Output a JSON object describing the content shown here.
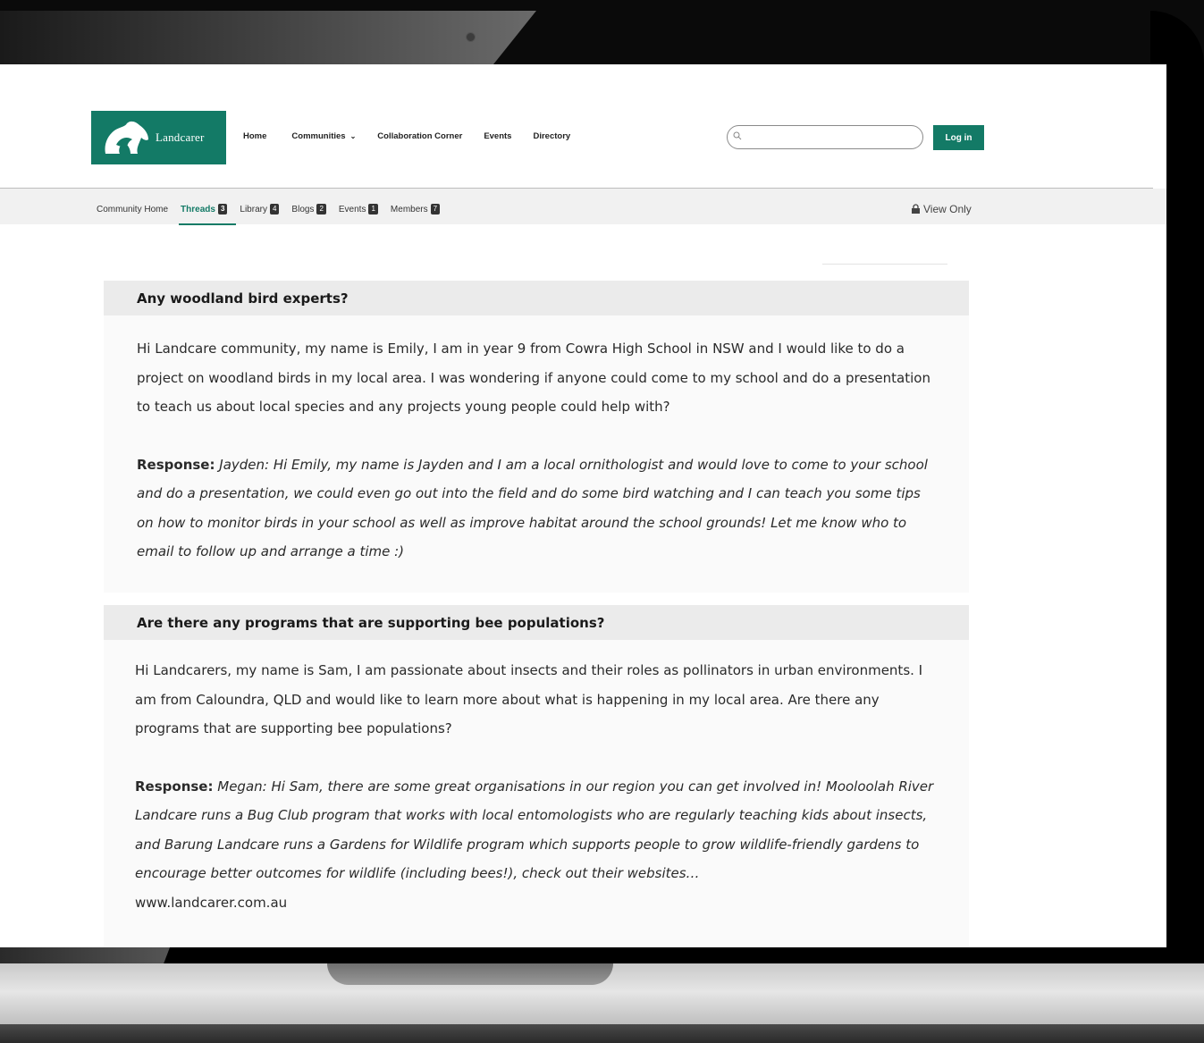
{
  "header": {
    "logo_text": "Landcarer",
    "nav": {
      "home": "Home",
      "communities": "Communities",
      "collaboration": "Collaboration Corner",
      "events": "Events",
      "directory": "Directory"
    },
    "search_placeholder": "",
    "login_label": "Log in"
  },
  "subnav": {
    "tabs": [
      {
        "label": "Community Home",
        "count": ""
      },
      {
        "label": "Threads",
        "count": "3"
      },
      {
        "label": "Library",
        "count": "4"
      },
      {
        "label": "Blogs",
        "count": "2"
      },
      {
        "label": "Events",
        "count": "1"
      },
      {
        "label": "Members",
        "count": "7"
      }
    ],
    "active_tab": "Threads",
    "view_only": "View Only"
  },
  "threads": [
    {
      "title": "Any woodland bird experts?",
      "body": "Hi Landcare community, my name is Emily, I am in year 9 from Cowra High School in NSW and I would like to do a project on woodland birds in my local area. I was wondering if anyone could come to my school and do a presentation to teach us about local species and any projects young people could help with?",
      "response_label": "Response:",
      "response": "Jayden: Hi Emily, my name is Jayden and I am a local ornithologist and would love to come to your school and do a presentation, we could even go out into the field and do some bird watching and I can teach you some tips on how to monitor birds in your school as well as improve habitat around the school grounds! Let me know who to email to follow up and arrange a time :)",
      "url": ""
    },
    {
      "title": "Are there any programs that are supporting bee populations?",
      "body": "Hi Landcarers, my name is Sam, I am passionate about insects and their roles as pollinators in urban environments. I am from Caloundra, QLD and would like to learn more about what is happening in my local area. Are there any programs that are supporting bee populations?",
      "response_label": "Response:",
      "response": "Megan: Hi Sam, there are some great organisations in our region you can get involved in! Mooloolah River Landcare runs a Bug Club program that works with local entomologists who are regularly teaching kids about insects, and Barung Landcare runs a Gardens for Wildlife program which supports people to grow wildlife-friendly gardens to encourage better outcomes for wildlife (including bees!), check out their websites…",
      "url": "www.landcarer.com.au"
    }
  ],
  "colors": {
    "brand_green": "#137a66",
    "thread_header_bg": "#ebebeb",
    "thread_body_bg": "#fafafa"
  }
}
